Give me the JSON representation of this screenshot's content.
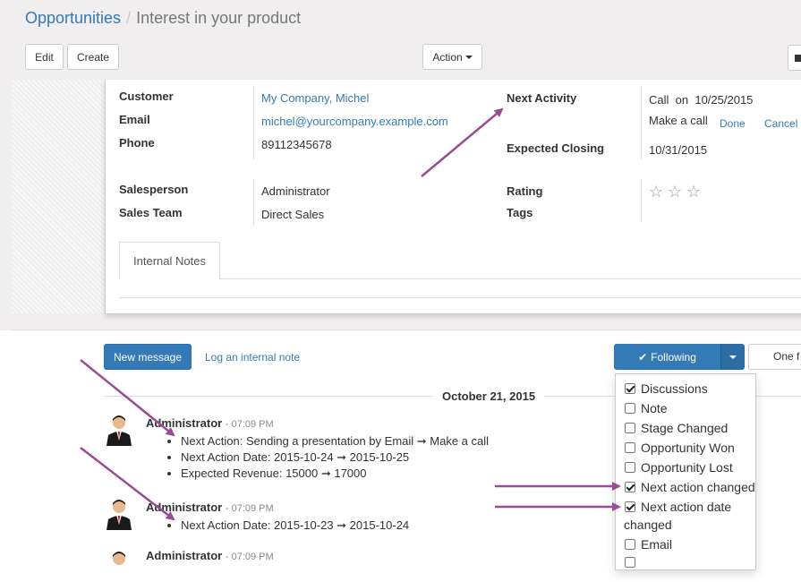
{
  "breadcrumb": {
    "root": "Opportunities",
    "separator": "/",
    "current": "Interest in your product"
  },
  "toolbar": {
    "edit": "Edit",
    "create": "Create",
    "action": "Action"
  },
  "form": {
    "customer_label": "Customer",
    "customer_value": "My Company, Michel",
    "email_label": "Email",
    "email_value": "michel@yourcompany.example.com",
    "phone_label": "Phone",
    "phone_value": "89112345678",
    "salesperson_label": "Salesperson",
    "salesperson_value": "Administrator",
    "sales_team_label": "Sales Team",
    "sales_team_value": "Direct Sales",
    "next_activity_label": "Next Activity",
    "next_activity_value": "Call",
    "next_activity_on": "on",
    "next_activity_date": "10/25/2015",
    "next_activity_summary": "Make a call",
    "done": "Done",
    "cancel": "Cancel",
    "expected_closing_label": "Expected Closing",
    "expected_closing_value": "10/31/2015",
    "rating_label": "Rating",
    "rating_stars": 0,
    "rating_max": 3,
    "tags_label": "Tags",
    "tab_internal_notes": "Internal Notes"
  },
  "chatter": {
    "new_message": "New message",
    "log_note": "Log an internal note",
    "following": "Following",
    "one_follower": "One f",
    "date_separator": "October 21, 2015",
    "messages": [
      {
        "author": "Administrator",
        "time": "- 07:09 PM",
        "changes": [
          "Next Action: Sending a presentation by Email ➞ Make a call",
          "Next Action Date: 2015-10-24 ➞ 2015-10-25",
          "Expected Revenue: 15000 ➞ 17000"
        ]
      },
      {
        "author": "Administrator",
        "time": "- 07:09 PM",
        "changes": [
          "Next Action Date: 2015-10-23 ➞ 2015-10-24"
        ]
      },
      {
        "author": "Administrator",
        "time": "- 07:09 PM"
      }
    ]
  },
  "subtypes": [
    {
      "label": "Discussions",
      "checked": true
    },
    {
      "label": "Note",
      "checked": false
    },
    {
      "label": "Stage Changed",
      "checked": false
    },
    {
      "label": "Opportunity Won",
      "checked": false
    },
    {
      "label": "Opportunity Lost",
      "checked": false
    },
    {
      "label": "Next action changed",
      "checked": true
    },
    {
      "label": "Next action date",
      "label_cont": "changed",
      "checked": true
    },
    {
      "label": "Email",
      "checked": false
    }
  ],
  "colors": {
    "link": "#337ab7",
    "primary": "#337ab7",
    "arrow": "#9b4a94"
  }
}
